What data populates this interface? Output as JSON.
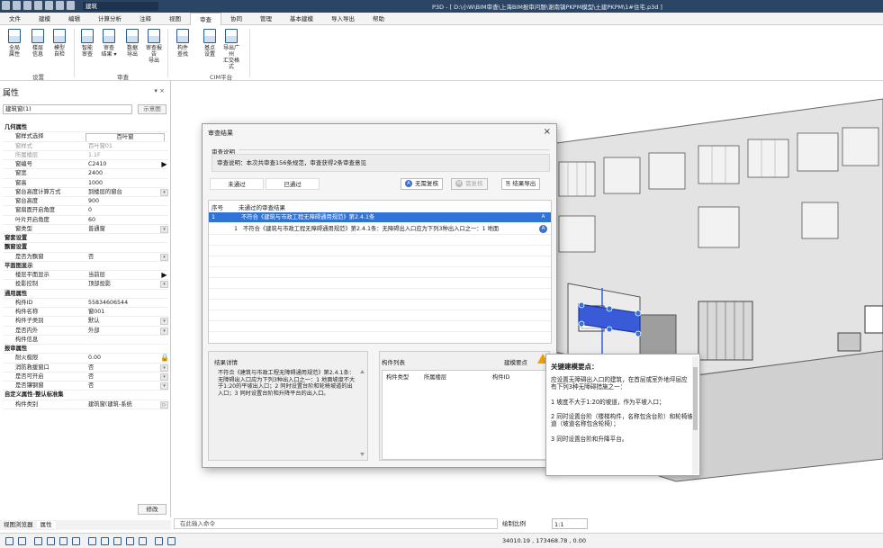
{
  "titlebar": {
    "combo_value": "建筑",
    "title": "P3D - [ D:\\小W\\BIM审查\\上海BIM报审问题\\谢南镇PKPM模型\\土建PKPM\\1#住宅.p3d ]"
  },
  "menu": [
    "文件",
    "建模",
    "编辑",
    "计算分析",
    "注释",
    "视图",
    "审查",
    "协同",
    "管理",
    "基本建模",
    "导入导出",
    "帮助"
  ],
  "menu_active": "审查",
  "ribbon": {
    "buttons": [
      {
        "label1": "全局",
        "label2": "属性"
      },
      {
        "label1": "楼层",
        "label2": "信息"
      },
      {
        "label1": "模型",
        "label2": "自检"
      },
      {
        "label1": "智能",
        "label2": "审查"
      },
      {
        "label1": "审查",
        "label2": "结果 ▾"
      },
      {
        "label1": "数据",
        "label2": "导出"
      },
      {
        "label1": "审查报告",
        "label2": "导出"
      },
      {
        "label1": "构件",
        "label2": "查找"
      },
      {
        "label1": "基点",
        "label2": "设置"
      },
      {
        "label1": "导出广州",
        "label2": "汇交格式"
      }
    ],
    "groups": [
      "设置",
      "审查",
      "CIM平台"
    ]
  },
  "props": {
    "header": "属性",
    "header_btns": "▾ ×",
    "type_combo": "建筑窗(1)",
    "edit_btn": "示意图",
    "rows": [
      {
        "k": "几何属性",
        "sec": true
      },
      {
        "k": "窗样式选择",
        "v": "百叶窗",
        "boxed": true
      },
      {
        "k": "窗样式",
        "v": "百叶窗01",
        "dim": true
      },
      {
        "k": "所属楼层",
        "v": "1.1F",
        "dim": true
      },
      {
        "k": "窗编号",
        "v": "C2410",
        "ctl": "▶"
      },
      {
        "k": "窗宽",
        "v": "2400"
      },
      {
        "k": "窗高",
        "v": "1000"
      },
      {
        "k": "窗台高度计算方式",
        "v": "到楼层的窗台",
        "ctl": "▾"
      },
      {
        "k": "窗台高度",
        "v": "900"
      },
      {
        "k": "窗扇面开启角度",
        "v": "0"
      },
      {
        "k": "叶片开启角度",
        "v": "60"
      },
      {
        "k": "窗类型",
        "v": "普通窗",
        "ctl": "▾"
      },
      {
        "k": "窗套设置",
        "sec": true
      },
      {
        "k": "飘窗设置",
        "sec": true
      },
      {
        "k": "是否为飘窗",
        "v": "否",
        "ctl": "▾"
      },
      {
        "k": "平面图显示",
        "sec": true
      },
      {
        "k": "楼层平面显示",
        "v": "当前层",
        "ctl": "▶"
      },
      {
        "k": "投影控制",
        "v": "顶部投影",
        "ctl": "▾"
      },
      {
        "k": "通用属性",
        "sec": true
      },
      {
        "k": "构件ID",
        "v": "55834606544"
      },
      {
        "k": "构件名称",
        "v": "窗001"
      },
      {
        "k": "构件子类别",
        "v": "默认",
        "ctl": "▾"
      },
      {
        "k": "是否内外",
        "v": "外部",
        "ctl": "▾"
      },
      {
        "k": "构件信息",
        "v": ""
      },
      {
        "k": "报审属性",
        "sec": true
      },
      {
        "k": "耐火极限",
        "v": "0.00",
        "ctl": "🔒"
      },
      {
        "k": "消防救援窗口",
        "v": "否",
        "ctl": "▾"
      },
      {
        "k": "是否可开启",
        "v": "否",
        "ctl": "▾"
      },
      {
        "k": "是否镶钢窗",
        "v": "否",
        "ctl": "▾"
      },
      {
        "k": "自定义属性-整认标准集",
        "sec": true
      },
      {
        "k": "构件类别",
        "v": "建筑窗(建筑-系统",
        "ctl": "▷"
      }
    ],
    "apply": "修改"
  },
  "bottom_tabs": [
    "视图浏览器",
    "属性"
  ],
  "cmdline_placeholder": "在此输入命令",
  "scale": {
    "label": "绘制比例",
    "value": "1:1"
  },
  "coords": "34010.19 , 173468.78 , 0.00",
  "dialog": {
    "title": "审查结果",
    "close": "×",
    "section": "审查说明",
    "description": "审查说明：本次共审查156条规范，审查获得2条审查意见",
    "tabs": [
      "未通过",
      "已通过"
    ],
    "btn_unannotated": "无需复核",
    "btn_annotated": "需复核",
    "btn_export": "结果导出",
    "table_headers": [
      "序号",
      "未通过的审查结果"
    ],
    "rows": [
      {
        "num": "1",
        "text": "不符合《建筑与市政工程无障碍通用规范》第2.4.1条",
        "badge": "A",
        "selected": true
      },
      {
        "num": "1",
        "text": "不符合《建筑与市政工程无障碍通用规范》第2.4.1条：无障碍出入口应为下列3种出入口之一：1 地面",
        "badge": "A",
        "selected": false
      }
    ],
    "detail_label": "结果详情",
    "detail_text": "不符合《建筑与市政工程无障碍通用规范》第2.4.1条：无障碍出入口应为下列3种出入口之一：1 地面坡度不大于1:20的平坡出入口；2 同时设置台阶和轮椅坡道的出入口；3 同时设置台阶和升降平台的出入口。",
    "comp_label": "构件列表",
    "comp_label2": "建模要点",
    "comp_headers": [
      "构件类型",
      "所属楼层",
      "构件ID"
    ]
  },
  "tip": {
    "title": "关键建模要点：",
    "body": "应设置无障碍出入口的建筑，在首层或室外地坪层应有下列3种无障碍措施之一：\n\n1 坡度不大于1:20的坡道，作为平坡入口；\n\n2 同时设置台阶（楼梯构件，名称包含台阶）和轮椅坡道（坡道名称包含轮椅）；\n\n3 同时设置台阶和升降平台。"
  },
  "colors": {
    "accent": "#2f73d8",
    "title_bar": "#2c4564",
    "warn": "#f0a000",
    "badge": "#3b6fd0"
  }
}
